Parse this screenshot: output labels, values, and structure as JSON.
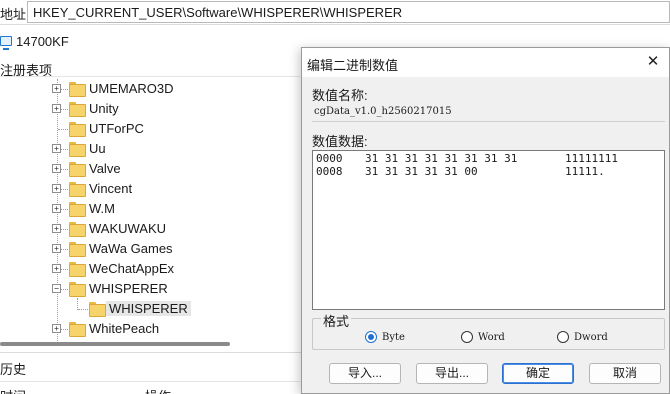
{
  "address_bar": {
    "label": "地址",
    "path": "HKEY_CURRENT_USER\\Software\\WHISPERER\\WHISPERER"
  },
  "tree": {
    "computer": "14700KF",
    "header": "注册表项",
    "items": [
      {
        "label": "UMEMARO3D",
        "expander": "+"
      },
      {
        "label": "Unity",
        "expander": "+"
      },
      {
        "label": "UTForPC",
        "expander": ""
      },
      {
        "label": "Uu",
        "expander": "+"
      },
      {
        "label": "Valve",
        "expander": "+"
      },
      {
        "label": "Vincent",
        "expander": "+"
      },
      {
        "label": "W.M",
        "expander": "+"
      },
      {
        "label": "WAKUWAKU",
        "expander": "+"
      },
      {
        "label": "WaWa Games",
        "expander": "+"
      },
      {
        "label": "WeChatAppEx",
        "expander": "+"
      },
      {
        "label": "WHISPERER",
        "expander": "−"
      },
      {
        "label": "WHISPERER",
        "expander": "",
        "child": true,
        "selected": true
      },
      {
        "label": "WhitePeach",
        "expander": "+"
      }
    ]
  },
  "bottom_panel": {
    "title": "历史",
    "col1": "时间",
    "col2": "操作"
  },
  "dialog": {
    "title": "编辑二进制数值",
    "close_icon": "✕",
    "name_label": "数值名称:",
    "name_value": "cgData_v1.0_h2560217015",
    "data_label": "数值数据:",
    "hex_rows": [
      {
        "offset": "0000",
        "bytes": "31 31 31 31 31 31 31 31",
        "ascii": "11111111"
      },
      {
        "offset": "0008",
        "bytes": "31 31 31 31 31 00",
        "ascii": "11111."
      }
    ],
    "format": {
      "label": "格式",
      "options": [
        {
          "label": "Byte",
          "checked": true
        },
        {
          "label": "Word",
          "checked": false
        },
        {
          "label": "Dword",
          "checked": false
        }
      ]
    },
    "buttons": {
      "import": "导入...",
      "export": "导出...",
      "ok": "确定",
      "cancel": "取消"
    }
  }
}
